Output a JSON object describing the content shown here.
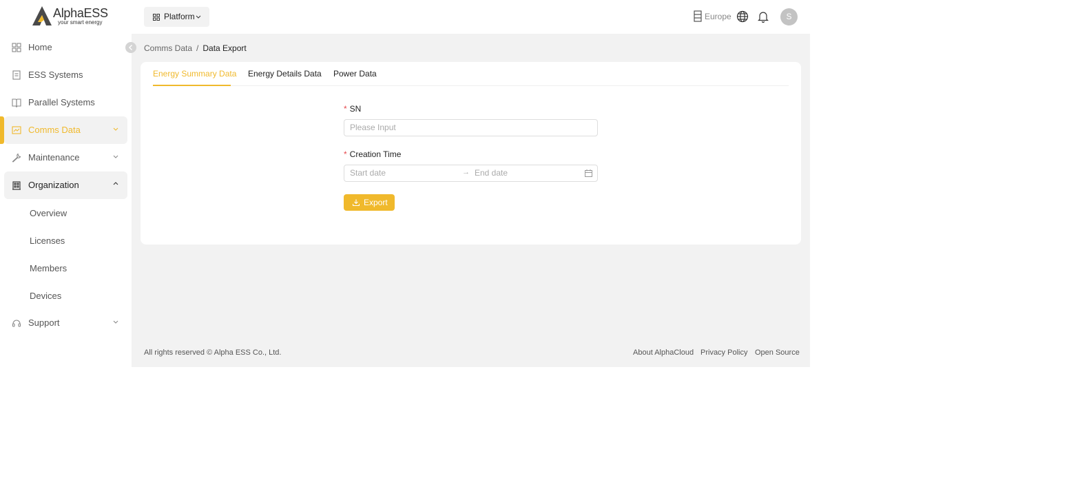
{
  "brand": {
    "name": "AlphaESS",
    "tagline": "your smart energy"
  },
  "sidebar": {
    "items": [
      {
        "label": "Home",
        "icon": "dashboard-icon"
      },
      {
        "label": "ESS Systems",
        "icon": "document-icon"
      },
      {
        "label": "Parallel Systems",
        "icon": "book-icon"
      },
      {
        "label": "Comms Data",
        "icon": "chart-monitor-icon",
        "state": "active",
        "chevron": "down"
      },
      {
        "label": "Maintenance",
        "icon": "wrench-icon",
        "chevron": "down"
      },
      {
        "label": "Organization",
        "icon": "building-icon",
        "state": "expanded",
        "chevron": "up"
      },
      {
        "label": "Support",
        "icon": "headset-icon",
        "chevron": "down"
      }
    ],
    "organization_children": [
      "Overview",
      "Licenses",
      "Members",
      "Devices"
    ]
  },
  "header": {
    "platform_label": "Platform",
    "region_label": "Europe",
    "avatar_initial": "S"
  },
  "breadcrumb": {
    "parent": "Comms Data",
    "separator": "/",
    "current": "Data Export"
  },
  "tabs": [
    {
      "label": "Energy Summary Data",
      "active": true
    },
    {
      "label": "Energy Details Data",
      "active": false
    },
    {
      "label": "Power Data",
      "active": false
    }
  ],
  "form": {
    "required_mark": "*",
    "sn": {
      "label": "SN",
      "placeholder": "Please Input",
      "value": ""
    },
    "creation_time": {
      "label": "Creation Time",
      "start_placeholder": "Start date",
      "end_placeholder": "End date",
      "separator": "→"
    },
    "export_label": "Export"
  },
  "footer": {
    "copyright": "All rights reserved © Alpha ESS Co., Ltd.",
    "links": [
      "About AlphaCloud",
      "Privacy Policy",
      "Open Source"
    ]
  },
  "colors": {
    "accent": "#f0b92c",
    "required": "#e5484d",
    "background": "#f2f2f2",
    "avatar": "#c3c3c3"
  }
}
